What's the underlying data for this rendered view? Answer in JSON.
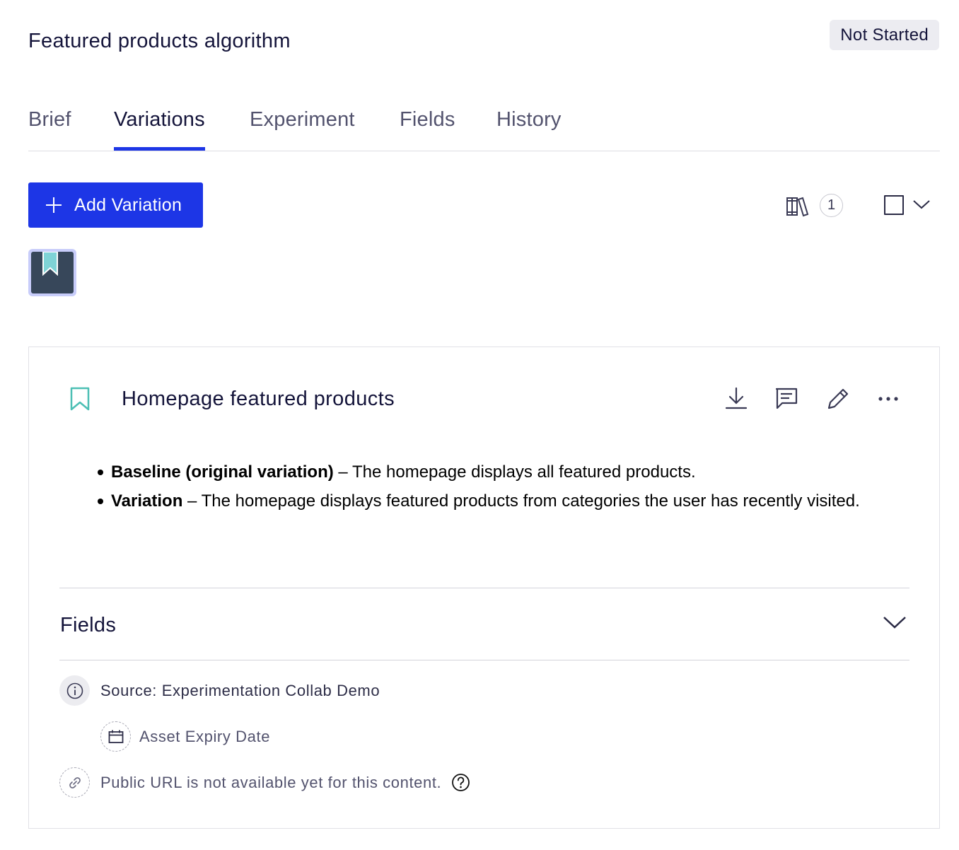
{
  "header": {
    "title": "Featured products algorithm",
    "status": "Not Started"
  },
  "tabs": [
    {
      "label": "Brief",
      "active": false
    },
    {
      "label": "Variations",
      "active": true
    },
    {
      "label": "Experiment",
      "active": false
    },
    {
      "label": "Fields",
      "active": false
    },
    {
      "label": "History",
      "active": false
    }
  ],
  "toolbar": {
    "add_variation_label": "Add Variation",
    "library_count": "1",
    "accent_color": "#1d36e6"
  },
  "variation": {
    "title": "Homepage featured products",
    "actions": [
      "download-icon",
      "comment-icon",
      "edit-icon",
      "more-icon"
    ],
    "description": [
      {
        "bold": "Baseline (original variation)",
        "text": " – The homepage displays all featured products."
      },
      {
        "bold": "Variation",
        "text": " – The homepage displays featured products from categories the user has recently visited."
      }
    ],
    "fields_heading": "Fields",
    "source": "Source: Experimentation Collab Demo",
    "asset_expiry_label": "Asset Expiry Date",
    "public_url_note": "Public URL is not available yet for this content."
  }
}
